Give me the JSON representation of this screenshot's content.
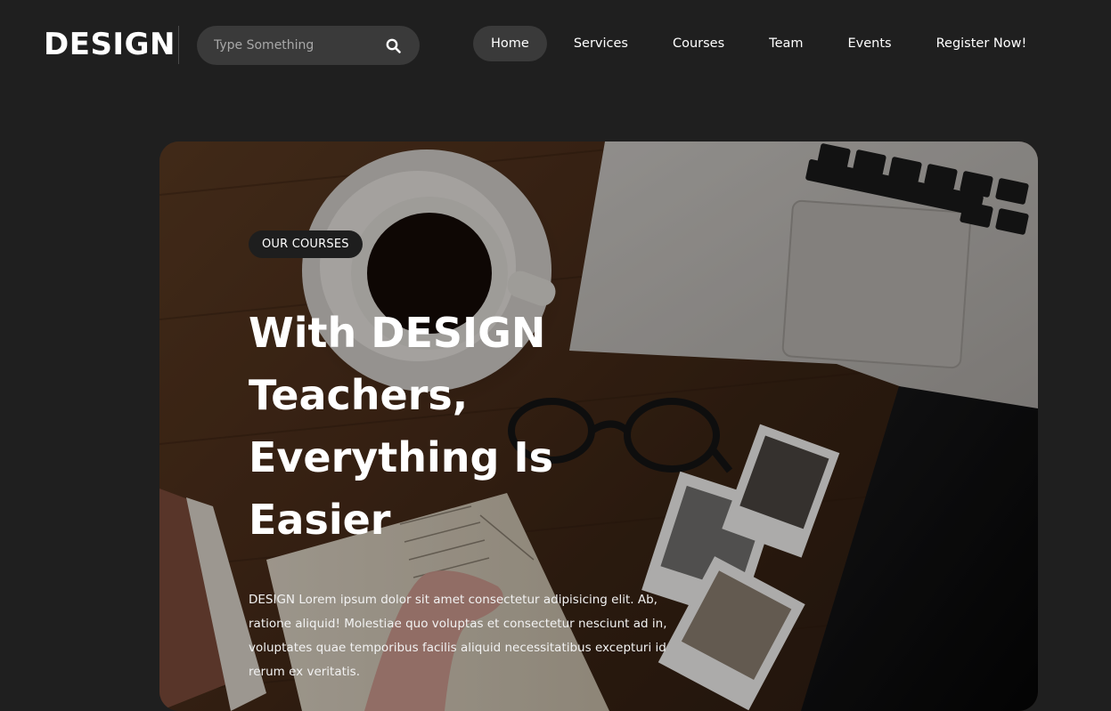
{
  "header": {
    "logo": "DESIGN",
    "search": {
      "placeholder": "Type Something",
      "icon": "search-icon"
    },
    "nav": [
      {
        "label": "Home",
        "active": true
      },
      {
        "label": "Services",
        "active": false
      },
      {
        "label": "Courses",
        "active": false
      },
      {
        "label": "Team",
        "active": false
      },
      {
        "label": "Events",
        "active": false
      },
      {
        "label": "Register Now!",
        "active": false
      }
    ]
  },
  "hero": {
    "badge": "OUR COURSES",
    "title": "With DESIGN Teachers, Everything Is Easier",
    "text": "DESIGN Lorem ipsum dolor sit amet consectetur adipisicing elit. Ab, ratione aliquid! Molestiae quo voluptas et consectetur nesciunt ad in, voluptates quae temporibus facilis aliquid necessitatibus excepturi id rerum ex veritatis.",
    "background_image": "desk-with-coffee-laptop-glasses-photos"
  },
  "colors": {
    "page_background": "#1f1f1f",
    "search_background": "#3a3a3a",
    "active_nav_background": "#3a3a3a",
    "badge_background": "#1e1e1e",
    "text": "#ffffff"
  }
}
